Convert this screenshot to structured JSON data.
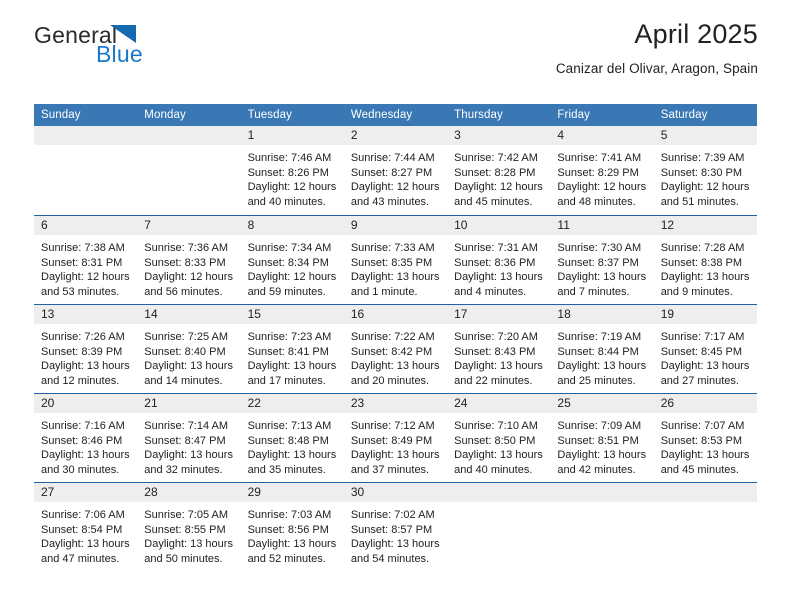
{
  "brand": {
    "name_part1": "General",
    "name_part2": "Blue",
    "triangle_color": "#1469b0",
    "blue_color": "#1e78c8"
  },
  "header": {
    "title": "April 2025",
    "subtitle": "Canizar del Olivar, Aragon, Spain"
  },
  "theme": {
    "header_bg": "#3a78b5",
    "row_divider": "#1f62a5",
    "day_band_bg": "#eeeeee",
    "text": "#222222"
  },
  "weekdays": [
    "Sunday",
    "Monday",
    "Tuesday",
    "Wednesday",
    "Thursday",
    "Friday",
    "Saturday"
  ],
  "weeks": [
    [
      {
        "day": "",
        "lines": [
          "",
          "",
          "",
          ""
        ]
      },
      {
        "day": "",
        "lines": [
          "",
          "",
          "",
          ""
        ]
      },
      {
        "day": "1",
        "lines": [
          "Sunrise: 7:46 AM",
          "Sunset: 8:26 PM",
          "Daylight: 12 hours",
          "and 40 minutes."
        ]
      },
      {
        "day": "2",
        "lines": [
          "Sunrise: 7:44 AM",
          "Sunset: 8:27 PM",
          "Daylight: 12 hours",
          "and 43 minutes."
        ]
      },
      {
        "day": "3",
        "lines": [
          "Sunrise: 7:42 AM",
          "Sunset: 8:28 PM",
          "Daylight: 12 hours",
          "and 45 minutes."
        ]
      },
      {
        "day": "4",
        "lines": [
          "Sunrise: 7:41 AM",
          "Sunset: 8:29 PM",
          "Daylight: 12 hours",
          "and 48 minutes."
        ]
      },
      {
        "day": "5",
        "lines": [
          "Sunrise: 7:39 AM",
          "Sunset: 8:30 PM",
          "Daylight: 12 hours",
          "and 51 minutes."
        ]
      }
    ],
    [
      {
        "day": "6",
        "lines": [
          "Sunrise: 7:38 AM",
          "Sunset: 8:31 PM",
          "Daylight: 12 hours",
          "and 53 minutes."
        ]
      },
      {
        "day": "7",
        "lines": [
          "Sunrise: 7:36 AM",
          "Sunset: 8:33 PM",
          "Daylight: 12 hours",
          "and 56 minutes."
        ]
      },
      {
        "day": "8",
        "lines": [
          "Sunrise: 7:34 AM",
          "Sunset: 8:34 PM",
          "Daylight: 12 hours",
          "and 59 minutes."
        ]
      },
      {
        "day": "9",
        "lines": [
          "Sunrise: 7:33 AM",
          "Sunset: 8:35 PM",
          "Daylight: 13 hours",
          "and 1 minute."
        ]
      },
      {
        "day": "10",
        "lines": [
          "Sunrise: 7:31 AM",
          "Sunset: 8:36 PM",
          "Daylight: 13 hours",
          "and 4 minutes."
        ]
      },
      {
        "day": "11",
        "lines": [
          "Sunrise: 7:30 AM",
          "Sunset: 8:37 PM",
          "Daylight: 13 hours",
          "and 7 minutes."
        ]
      },
      {
        "day": "12",
        "lines": [
          "Sunrise: 7:28 AM",
          "Sunset: 8:38 PM",
          "Daylight: 13 hours",
          "and 9 minutes."
        ]
      }
    ],
    [
      {
        "day": "13",
        "lines": [
          "Sunrise: 7:26 AM",
          "Sunset: 8:39 PM",
          "Daylight: 13 hours",
          "and 12 minutes."
        ]
      },
      {
        "day": "14",
        "lines": [
          "Sunrise: 7:25 AM",
          "Sunset: 8:40 PM",
          "Daylight: 13 hours",
          "and 14 minutes."
        ]
      },
      {
        "day": "15",
        "lines": [
          "Sunrise: 7:23 AM",
          "Sunset: 8:41 PM",
          "Daylight: 13 hours",
          "and 17 minutes."
        ]
      },
      {
        "day": "16",
        "lines": [
          "Sunrise: 7:22 AM",
          "Sunset: 8:42 PM",
          "Daylight: 13 hours",
          "and 20 minutes."
        ]
      },
      {
        "day": "17",
        "lines": [
          "Sunrise: 7:20 AM",
          "Sunset: 8:43 PM",
          "Daylight: 13 hours",
          "and 22 minutes."
        ]
      },
      {
        "day": "18",
        "lines": [
          "Sunrise: 7:19 AM",
          "Sunset: 8:44 PM",
          "Daylight: 13 hours",
          "and 25 minutes."
        ]
      },
      {
        "day": "19",
        "lines": [
          "Sunrise: 7:17 AM",
          "Sunset: 8:45 PM",
          "Daylight: 13 hours",
          "and 27 minutes."
        ]
      }
    ],
    [
      {
        "day": "20",
        "lines": [
          "Sunrise: 7:16 AM",
          "Sunset: 8:46 PM",
          "Daylight: 13 hours",
          "and 30 minutes."
        ]
      },
      {
        "day": "21",
        "lines": [
          "Sunrise: 7:14 AM",
          "Sunset: 8:47 PM",
          "Daylight: 13 hours",
          "and 32 minutes."
        ]
      },
      {
        "day": "22",
        "lines": [
          "Sunrise: 7:13 AM",
          "Sunset: 8:48 PM",
          "Daylight: 13 hours",
          "and 35 minutes."
        ]
      },
      {
        "day": "23",
        "lines": [
          "Sunrise: 7:12 AM",
          "Sunset: 8:49 PM",
          "Daylight: 13 hours",
          "and 37 minutes."
        ]
      },
      {
        "day": "24",
        "lines": [
          "Sunrise: 7:10 AM",
          "Sunset: 8:50 PM",
          "Daylight: 13 hours",
          "and 40 minutes."
        ]
      },
      {
        "day": "25",
        "lines": [
          "Sunrise: 7:09 AM",
          "Sunset: 8:51 PM",
          "Daylight: 13 hours",
          "and 42 minutes."
        ]
      },
      {
        "day": "26",
        "lines": [
          "Sunrise: 7:07 AM",
          "Sunset: 8:53 PM",
          "Daylight: 13 hours",
          "and 45 minutes."
        ]
      }
    ],
    [
      {
        "day": "27",
        "lines": [
          "Sunrise: 7:06 AM",
          "Sunset: 8:54 PM",
          "Daylight: 13 hours",
          "and 47 minutes."
        ]
      },
      {
        "day": "28",
        "lines": [
          "Sunrise: 7:05 AM",
          "Sunset: 8:55 PM",
          "Daylight: 13 hours",
          "and 50 minutes."
        ]
      },
      {
        "day": "29",
        "lines": [
          "Sunrise: 7:03 AM",
          "Sunset: 8:56 PM",
          "Daylight: 13 hours",
          "and 52 minutes."
        ]
      },
      {
        "day": "30",
        "lines": [
          "Sunrise: 7:02 AM",
          "Sunset: 8:57 PM",
          "Daylight: 13 hours",
          "and 54 minutes."
        ]
      },
      {
        "day": "",
        "lines": [
          "",
          "",
          "",
          ""
        ]
      },
      {
        "day": "",
        "lines": [
          "",
          "",
          "",
          ""
        ]
      },
      {
        "day": "",
        "lines": [
          "",
          "",
          "",
          ""
        ]
      }
    ]
  ]
}
